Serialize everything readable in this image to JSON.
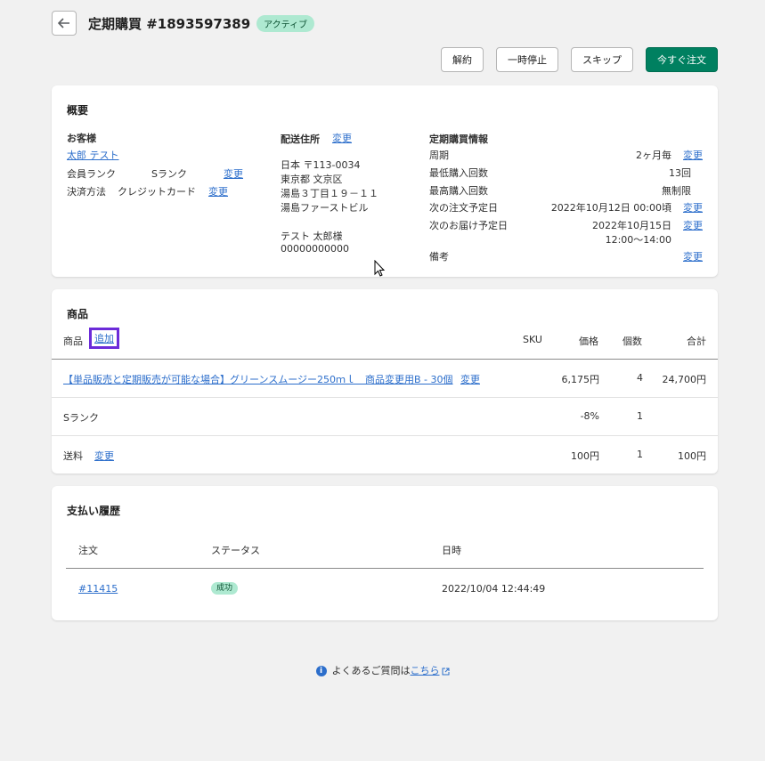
{
  "header": {
    "title": "定期購買 #1893597389",
    "status": "アクティブ"
  },
  "actions": {
    "cancel": "解約",
    "pause": "一時停止",
    "skip": "スキップ",
    "order_now": "今すぐ注文"
  },
  "summary": {
    "title": "概要",
    "customer": {
      "heading": "お客様",
      "name": "太郎 テスト",
      "rank_label": "会員ランク",
      "rank_value": "Sランク",
      "rank_change": "変更",
      "payment_label": "決済方法",
      "payment_value": "クレジットカード",
      "payment_change": "変更"
    },
    "shipping": {
      "heading": "配送住所",
      "change": "変更",
      "lines": [
        "日本 〒113-0034",
        "東京都 文京区",
        "湯島３丁目１９－１１",
        "湯島ファーストビル"
      ],
      "name": "テスト 太郎様",
      "phone": "00000000000"
    },
    "subscription": {
      "heading": "定期購買情報",
      "cycle_label": "周期",
      "cycle_value": "2ヶ月毎",
      "cycle_change": "変更",
      "min_label": "最低購入回数",
      "min_value": "13回",
      "max_label": "最高購入回数",
      "max_value": "無制限",
      "next_order_label": "次の注文予定日",
      "next_order_value": "2022年10月12日 00:00頃",
      "next_order_change": "変更",
      "next_delivery_label": "次のお届け予定日",
      "next_delivery_value": "2022年10月15日",
      "next_delivery_time": "12:00～14:00",
      "next_delivery_change": "変更",
      "note_label": "備考",
      "note_change": "変更"
    }
  },
  "products": {
    "title": "商品",
    "columns": {
      "product": "商品",
      "add": "追加",
      "sku": "SKU",
      "price": "価格",
      "qty": "個数",
      "total": "合計"
    },
    "rows": [
      {
        "name": "【単品販売と定期販売が可能な場合】グリーンスムージー250ｍｌ　商品変更用B - 30個",
        "change": "変更",
        "price": "6,175円",
        "qty": "4",
        "total": "24,700円"
      },
      {
        "name": "Sランク",
        "price": "-8%",
        "qty": "1",
        "total": ""
      },
      {
        "name": "送料",
        "change": "変更",
        "price": "100円",
        "qty": "1",
        "total": "100円"
      }
    ]
  },
  "payments": {
    "title": "支払い履歴",
    "columns": {
      "order": "注文",
      "status": "ステータス",
      "datetime": "日時"
    },
    "rows": [
      {
        "order": "#11415",
        "status": "成功",
        "datetime": "2022/10/04 12:44:49"
      }
    ]
  },
  "footer": {
    "text": "よくあるご質問は",
    "link": "こちら"
  }
}
